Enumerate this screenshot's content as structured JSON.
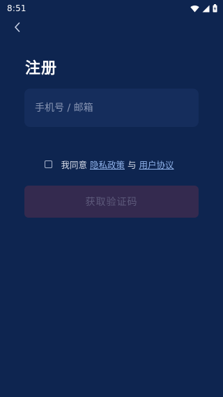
{
  "status_bar": {
    "time": "8:51",
    "icons": [
      "wifi-icon",
      "cellular-signal-icon",
      "battery-icon"
    ]
  },
  "nav": {
    "back_icon": "chevron-left-icon"
  },
  "page": {
    "title": "注册"
  },
  "form": {
    "account_placeholder": "手机号 / 邮箱",
    "account_value": ""
  },
  "agreement": {
    "prefix": "我同意",
    "privacy_link": "隐私政策",
    "connector": "与",
    "terms_link": "用户协议",
    "checked": false
  },
  "actions": {
    "get_code_label": "获取验证码"
  },
  "colors": {
    "background": "#0e2550",
    "input_background": "#152d5c",
    "button_disabled_background": "#342a4f",
    "button_disabled_text": "#5d5a7b",
    "link": "#8fb2ea"
  }
}
